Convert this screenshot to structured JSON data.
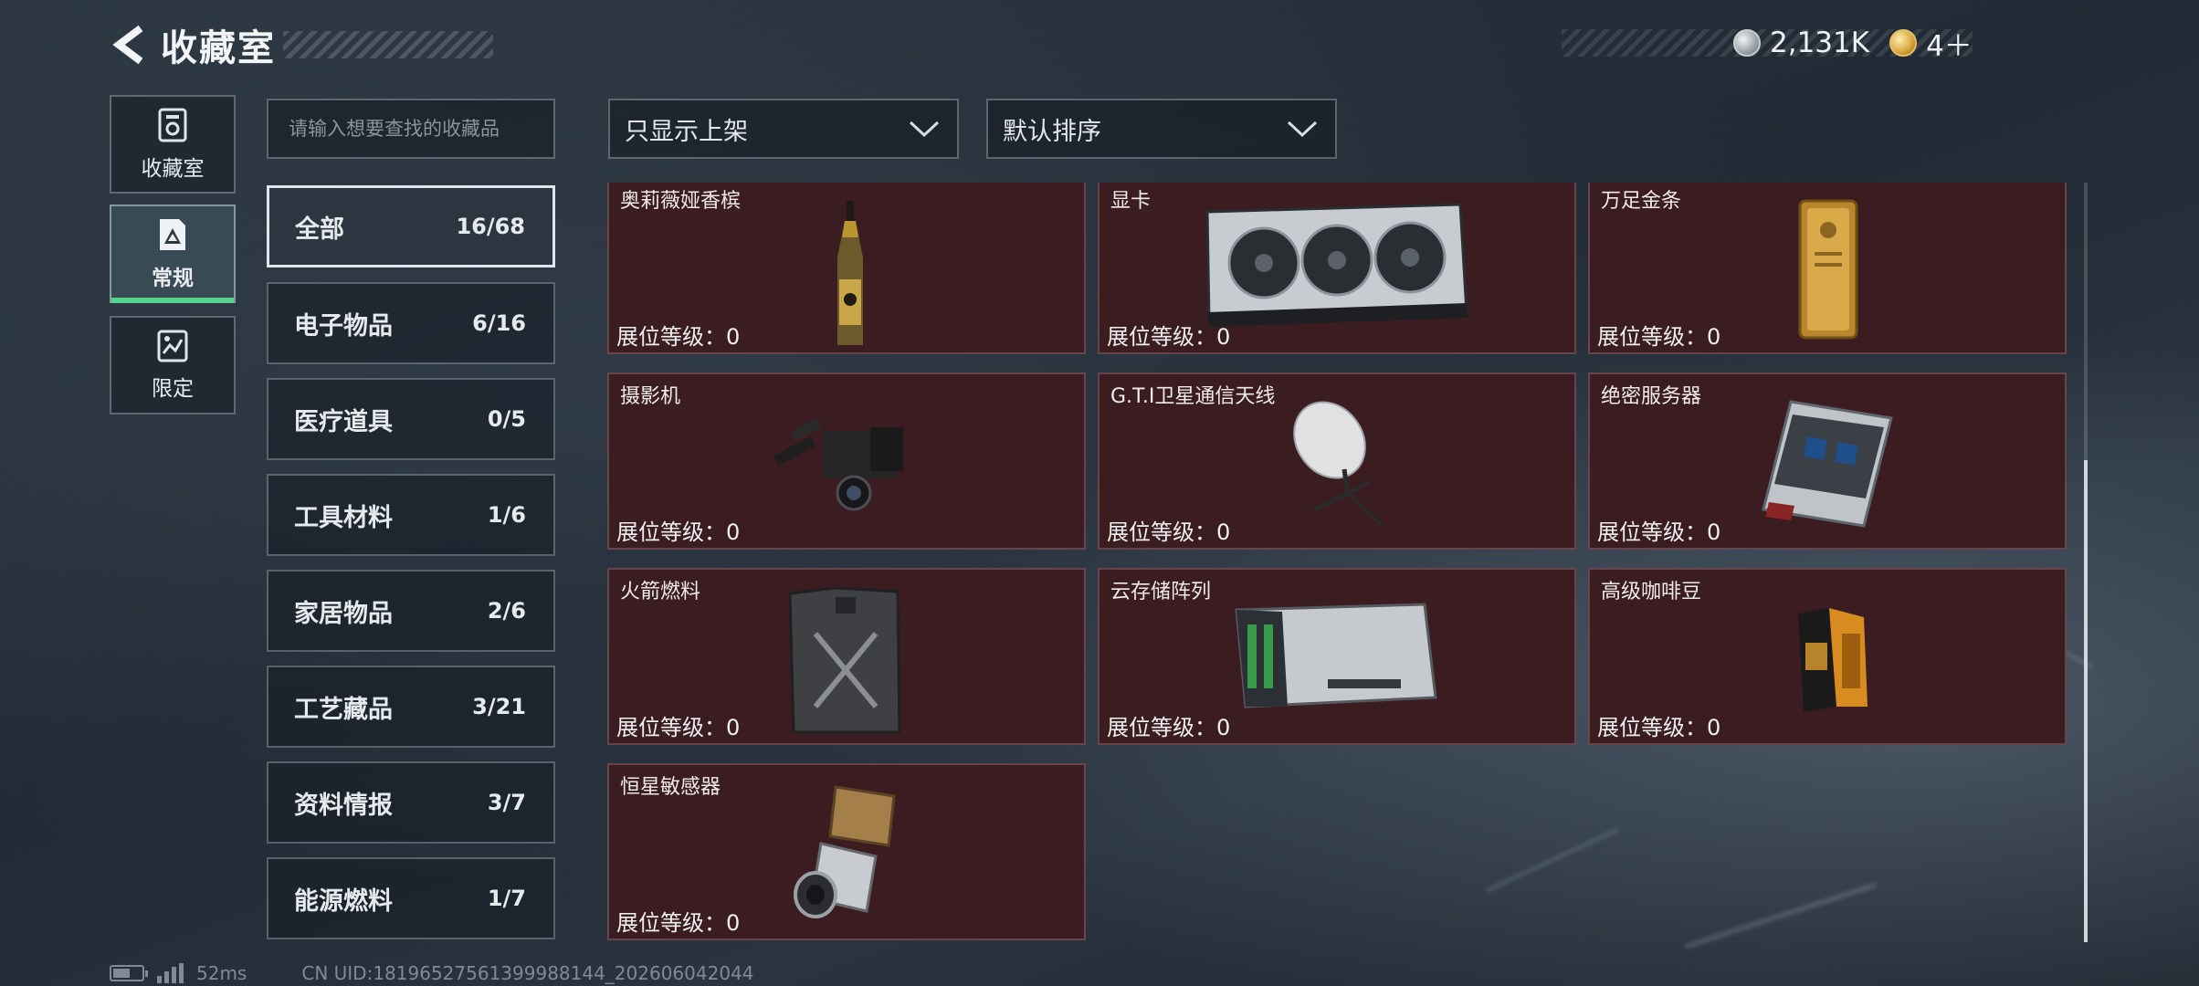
{
  "header": {
    "title": "收藏室",
    "currencies": [
      {
        "icon": "silver-coin-icon",
        "value": "2,131K"
      },
      {
        "icon": "gold-coin-icon",
        "value": "4＋"
      }
    ]
  },
  "side_tabs": [
    {
      "label": "收藏室",
      "icon": "collection-room-icon",
      "active": false
    },
    {
      "label": "常规",
      "icon": "regular-icon",
      "active": true
    },
    {
      "label": "限定",
      "icon": "limited-icon",
      "active": false
    }
  ],
  "search": {
    "placeholder": "请输入想要查找的收藏品"
  },
  "filters": {
    "listed": {
      "value": "只显示上架"
    },
    "sort": {
      "value": "默认排序"
    }
  },
  "categories": [
    {
      "name": "全部",
      "count": "16/68",
      "active": true
    },
    {
      "name": "电子物品",
      "count": "6/16"
    },
    {
      "name": "医疗道具",
      "count": "0/5"
    },
    {
      "name": "工具材料",
      "count": "1/6"
    },
    {
      "name": "家居物品",
      "count": "2/6"
    },
    {
      "name": "工艺藏品",
      "count": "3/21"
    },
    {
      "name": "资料情报",
      "count": "3/7"
    },
    {
      "name": "能源燃料",
      "count": "1/7"
    }
  ],
  "items": [
    {
      "name": "奥莉薇娅香槟",
      "level_label": "展位等级：0",
      "icon": "champagne-bottle-icon"
    },
    {
      "name": "显卡",
      "level_label": "展位等级：0",
      "icon": "graphics-card-icon"
    },
    {
      "name": "万足金条",
      "level_label": "展位等级：0",
      "icon": "gold-bar-icon"
    },
    {
      "name": "摄影机",
      "level_label": "展位等级：0",
      "icon": "video-camera-icon"
    },
    {
      "name": "G.T.I卫星通信天线",
      "level_label": "展位等级：0",
      "icon": "satellite-dish-icon"
    },
    {
      "name": "绝密服务器",
      "level_label": "展位等级：0",
      "icon": "server-icon"
    },
    {
      "name": "火箭燃料",
      "level_label": "展位等级：0",
      "icon": "fuel-canister-icon"
    },
    {
      "name": "云存储阵列",
      "level_label": "展位等级：0",
      "icon": "storage-array-icon"
    },
    {
      "name": "高级咖啡豆",
      "level_label": "展位等级：0",
      "icon": "coffee-bag-icon"
    },
    {
      "name": "恒星敏感器",
      "level_label": "展位等级：0",
      "icon": "star-sensor-icon"
    }
  ],
  "status_bar": {
    "ping": "52ms",
    "uid": "CN UID:18196527561399988144_202606042044"
  }
}
